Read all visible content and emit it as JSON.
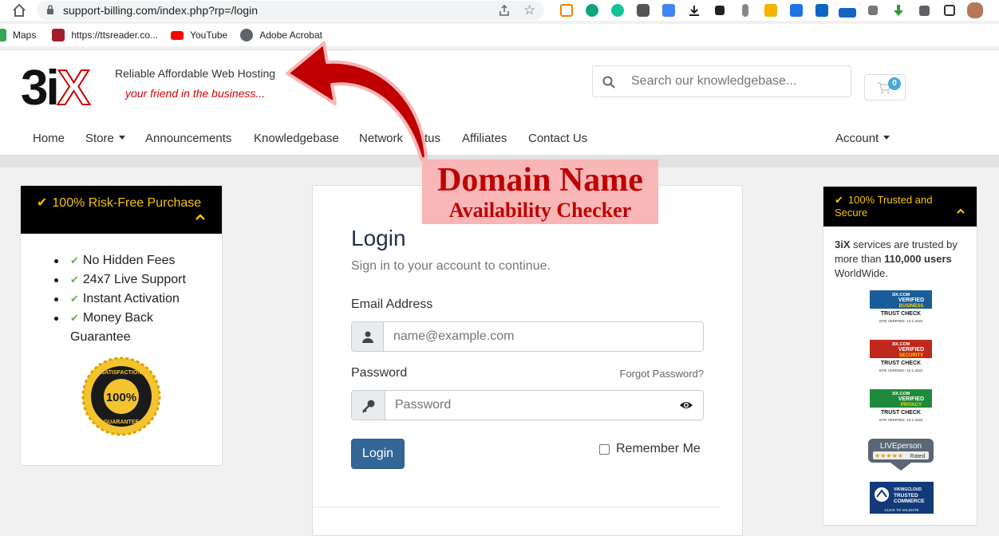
{
  "browser": {
    "url": "support-billing.com/index.php?rp=/login",
    "bookmarks": [
      {
        "label": "Maps",
        "icon": "maps-icon",
        "color": "#34a853"
      },
      {
        "label": "https://ttsreader.co...",
        "icon": "ttsreader-icon",
        "color": "#a51d2d"
      },
      {
        "label": "YouTube",
        "icon": "youtube-icon",
        "color": "#ff0000"
      },
      {
        "label": "Adobe Acrobat",
        "icon": "globe-icon",
        "color": "#5f6368"
      }
    ],
    "extensions": [
      "ext-orange-icon",
      "ext-a-icon",
      "ext-grammarly-icon",
      "ext-hex-icon",
      "ext-translate-icon",
      "download-icon",
      "ext-qr-icon",
      "mic-icon",
      "clipboard-icon",
      "ext-arrow-icon",
      "linkedin-icon",
      "redir-icon",
      "ext-shape-icon",
      "green-down-icon",
      "puzzle-icon",
      "sidepanel-icon",
      "avatar"
    ]
  },
  "site": {
    "logo_digit": "3i",
    "logo_x": "X",
    "tagline": "Reliable Affordable Web Hosting",
    "tagline2": "your friend in the business...",
    "search_placeholder": "Search our knowledgebase...",
    "cart_count": "0",
    "nav": {
      "home": "Home",
      "store": "Store",
      "announcements": "Announcements",
      "knowledgebase": "Knowledgebase",
      "network": "Network",
      "status_tail": "tus",
      "affiliates": "Affiliates",
      "contact": "Contact Us",
      "account": "Account"
    }
  },
  "left_panel": {
    "title": "100% Risk-Free Purchase",
    "features": [
      "No Hidden Fees",
      "24x7 Live Support",
      "Instant Activation",
      "Money Back Guarantee"
    ],
    "seal_text": "SATISFACTION 100% GUARANTEE"
  },
  "login": {
    "title": "Login",
    "subtitle": "Sign in to your account to continue.",
    "email_label": "Email Address",
    "email_placeholder": "name@example.com",
    "password_label": "Password",
    "forgot": "Forgot Password?",
    "password_placeholder": "Password",
    "button": "Login",
    "remember": "Remember Me"
  },
  "right_panel": {
    "title": "100% Trusted and Secure",
    "text_a": "3iX",
    "text_b": " services are trusted by more than ",
    "text_c": "110,000 users",
    "text_d": " WorldWide.",
    "badges": [
      {
        "name": "verified-business-trust-check",
        "lines": [
          "3IX.COM",
          "VERIFIED",
          "BUSINESS",
          "TRUST CHECK",
          "SITE VERIFIED: 12-1-2024"
        ],
        "color": "#1a5d9a"
      },
      {
        "name": "verified-security-trust-check",
        "lines": [
          "3IX.COM",
          "VERIFIED",
          "SECURITY",
          "TRUST CHECK",
          "SITE VERIFIED: 12-1-2024"
        ],
        "color": "#c0281c"
      },
      {
        "name": "verified-privacy-trust-check",
        "lines": [
          "3IX.COM",
          "VERIFIED",
          "PRIVACY",
          "TRUST CHECK",
          "SITE VERIFIED: 12-1-2024"
        ],
        "color": "#1f8a3a"
      },
      {
        "name": "liveperson-rated",
        "lines": [
          "LIVEperson",
          "Rated"
        ],
        "color": "#5a6775"
      },
      {
        "name": "vikingcloud-trusted-commerce",
        "lines": [
          "VIKINGCLOUD",
          "TRUSTED",
          "COMMERCE",
          "CLICK TO VALIDATE"
        ],
        "color": "#123a78"
      }
    ]
  },
  "annotation": {
    "line1": "Domain Name",
    "line2": "Availability Checker",
    "color": "#c00000"
  }
}
